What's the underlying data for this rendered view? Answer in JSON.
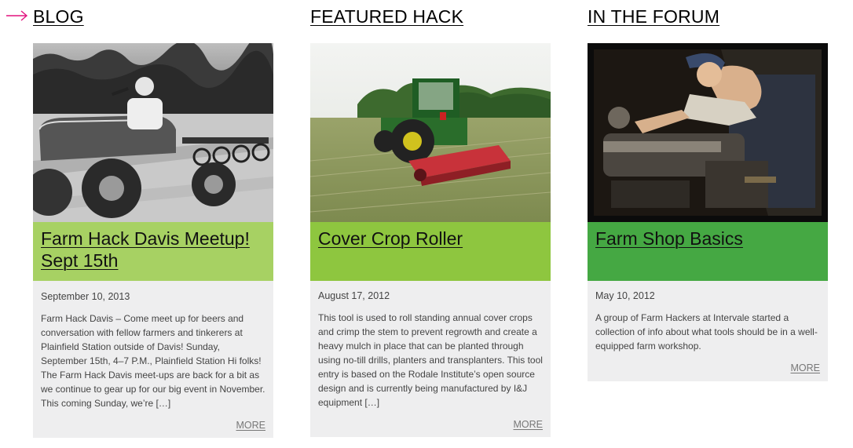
{
  "colors": {
    "accent_arrow": "#e2127f",
    "blog_green": "#a7d163",
    "hack_green": "#8ec63f",
    "forum_green": "#45a843",
    "card_bg": "#eeeeef"
  },
  "icons": {
    "section_indicator": "right-arrow-icon"
  },
  "columns": [
    {
      "heading": "BLOG",
      "image_alt": "Black and white photo of a man driving an old tractor pulling a disc harrow",
      "title": "Farm Hack Davis Meetup! Sept 15th",
      "date": "September 10, 2013",
      "excerpt": "Farm Hack Davis – Come meet up for beers and conversation with fellow farmers and tinkerers at Plainfield Station outside of Davis! Sunday, September 15th, 4–7 P.M., Plainfield Station  Hi folks! The Farm Hack Davis meet-ups are back for a bit as we continue to gear up for our big event in November. This coming Sunday, we’re […]",
      "more": "MORE"
    },
    {
      "heading": "FEATURED HACK",
      "image_alt": "Green tractor pushing a red cover crop roller through a tall grass field",
      "title": "Cover Crop Roller",
      "date": "August 17, 2012",
      "excerpt": "This tool is used to roll standing annual cover crops and crimp the stem to prevent regrowth and create a heavy mulch in place that can be planted through using no-till drills, planters and transplanters. This tool entry is based on the Rodale Institute’s open source design and is currently being manufactured by I&J equipment […]",
      "more": "MORE"
    },
    {
      "heading": "IN THE FORUM",
      "image_alt": "Vintage color photo of a woman machinist operating a lathe in a workshop",
      "title": "Farm Shop Basics",
      "date": "May 10, 2012",
      "excerpt": "A group of Farm Hackers at Intervale started a collection of info about what tools should be in a well-equipped farm workshop.",
      "more": "MORE"
    }
  ]
}
